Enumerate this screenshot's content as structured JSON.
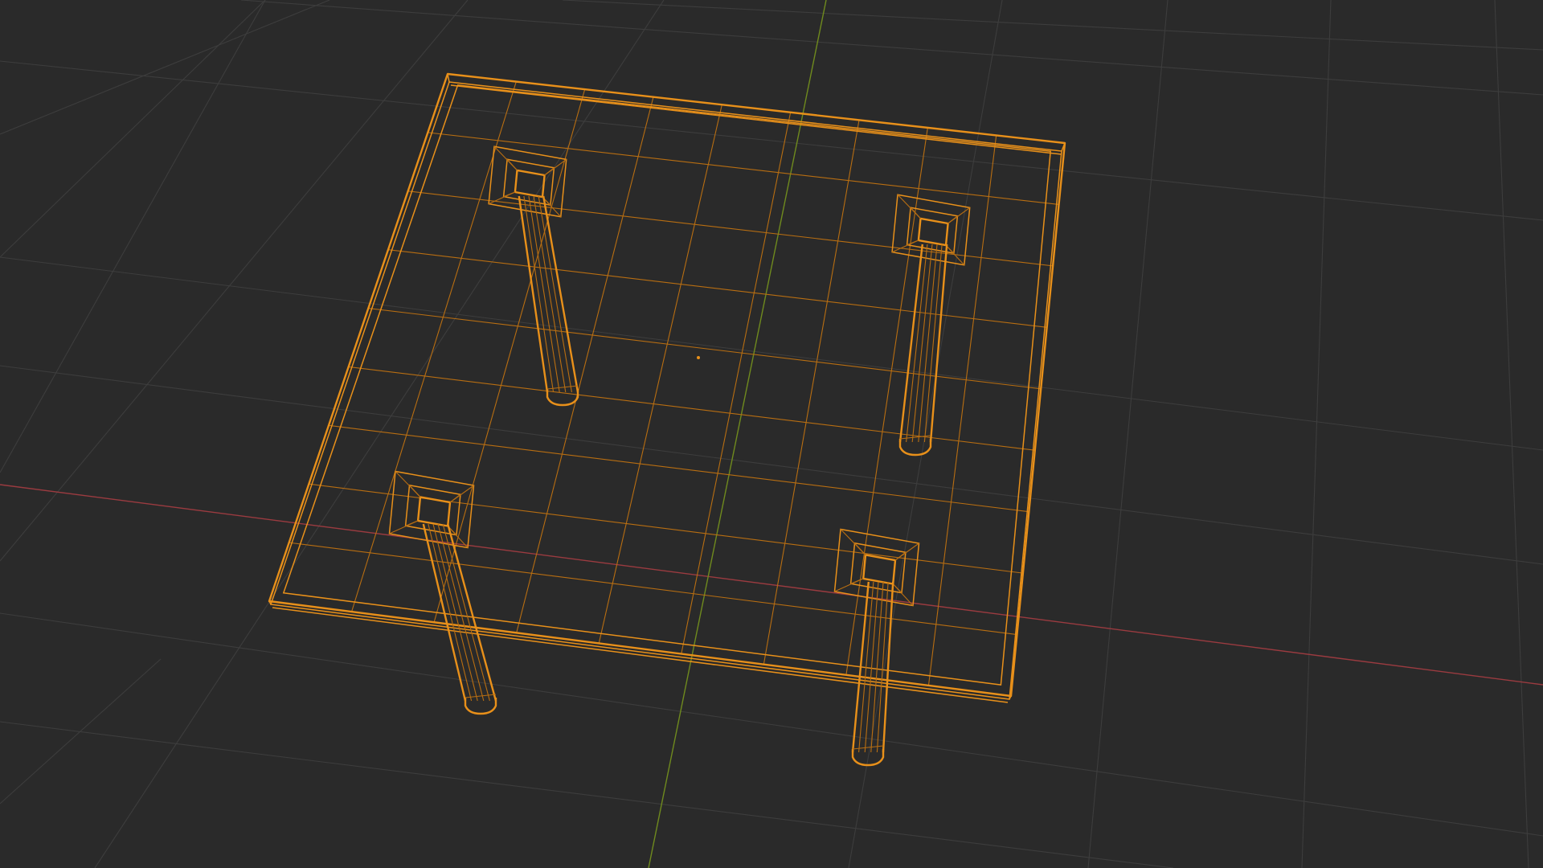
{
  "viewport": {
    "mode": "wireframe",
    "selected_object": "table",
    "selection_state": "selected"
  },
  "colors": {
    "background": "#2a2a2a",
    "grid": "#3d3d3d",
    "x_axis": "#9b3b40",
    "y_axis": "#6f8a1e",
    "wire_selected": "#e8901a",
    "wire_selected_dim": "#b86e12",
    "origin": "#e8901a"
  }
}
